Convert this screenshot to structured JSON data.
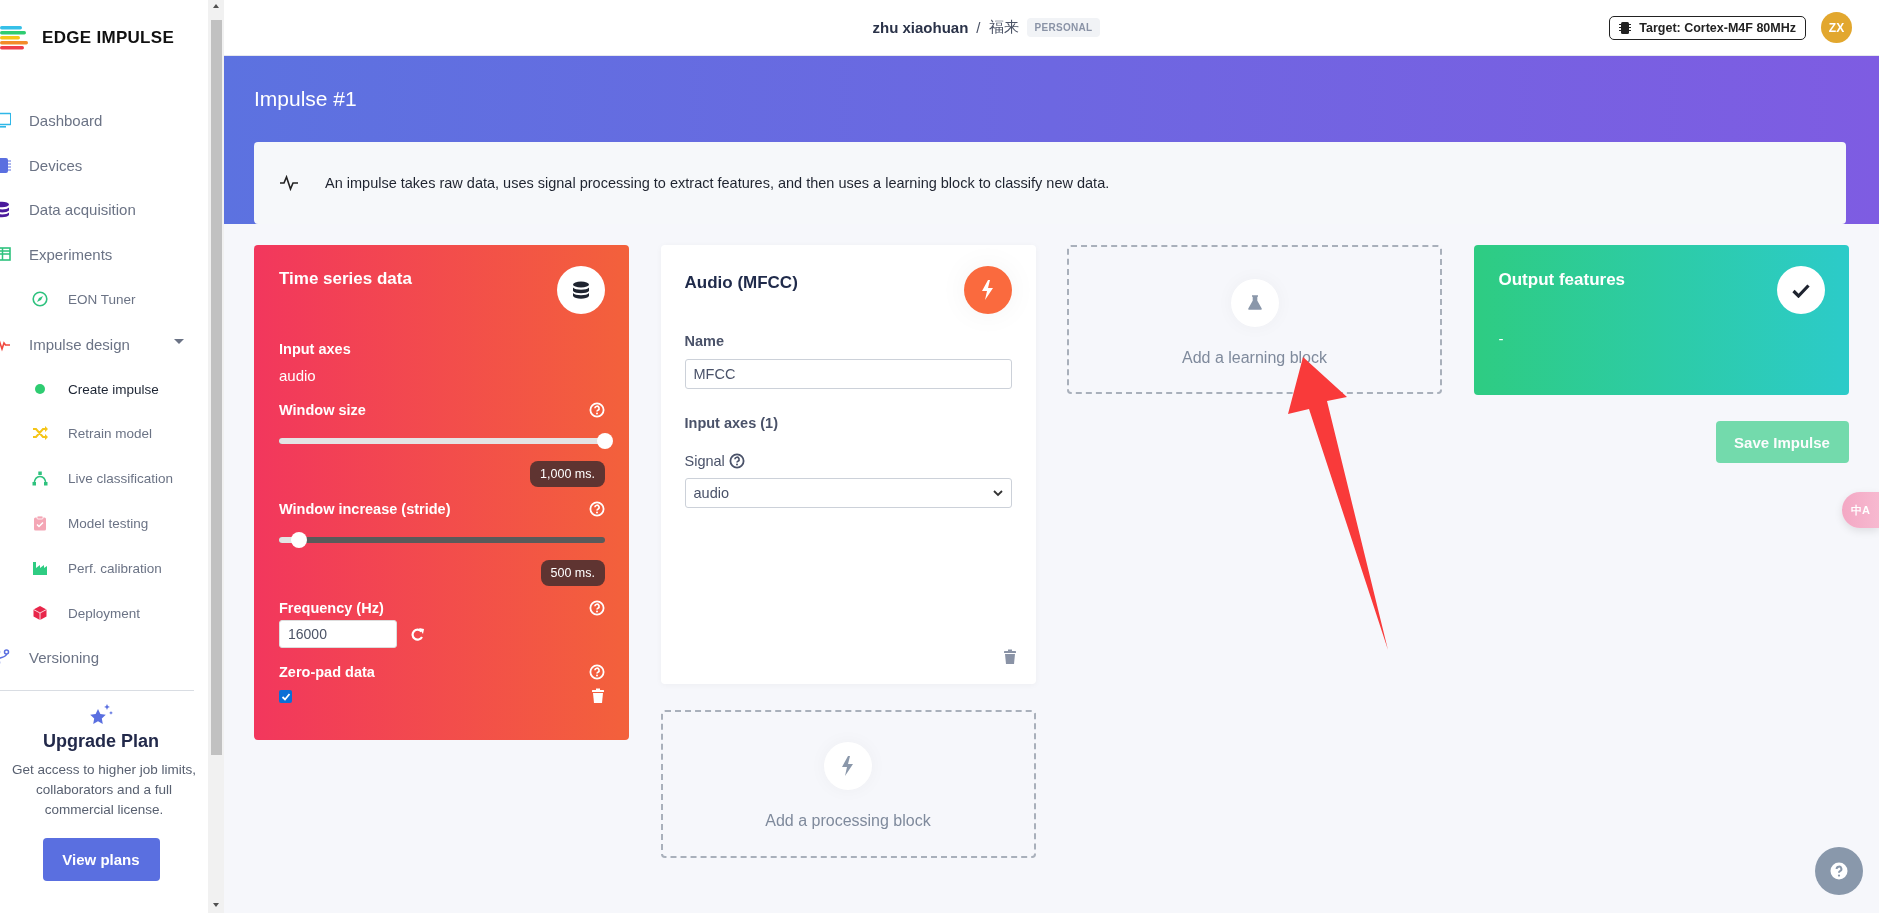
{
  "sidebar": {
    "logo_text": "EDGE IMPULSE",
    "items": [
      {
        "label": "Dashboard",
        "selected": false
      },
      {
        "label": "Devices",
        "selected": false
      },
      {
        "label": "Data acquisition",
        "selected": false
      },
      {
        "label": "Experiments",
        "selected": false,
        "children": [
          {
            "label": "EON Tuner",
            "selected": false
          }
        ]
      },
      {
        "label": "Impulse design",
        "selected": false,
        "expanded": true,
        "children": [
          {
            "label": "Create impulse",
            "selected": true
          },
          {
            "label": "Retrain model",
            "selected": false
          },
          {
            "label": "Live classification",
            "selected": false
          },
          {
            "label": "Model testing",
            "selected": false
          },
          {
            "label": "Perf. calibration",
            "selected": false
          },
          {
            "label": "Deployment",
            "selected": false
          }
        ]
      },
      {
        "label": "Versioning",
        "selected": false
      }
    ],
    "upgrade": {
      "title": "Upgrade Plan",
      "text": "Get access to higher job limits, collaborators and a full commercial license.",
      "button": "View plans"
    }
  },
  "topbar": {
    "user": "zhu xiaohuan",
    "separator": "/",
    "project": "福来",
    "badge": "PERSONAL",
    "target": "Target: Cortex-M4F 80MHz",
    "avatar": "ZX"
  },
  "header": {
    "title": "Impulse #1",
    "info": "An impulse takes raw data, uses signal processing to extract features, and then uses a learning block to classify new data."
  },
  "input_block": {
    "title": "Time series data",
    "axes_label": "Input axes",
    "axes_value": "audio",
    "sliders": [
      {
        "label": "Window size",
        "level": 1.0,
        "reading": "1,000 ms."
      },
      {
        "label": "Window increase (stride)",
        "level": 0.06,
        "reading": "500 ms."
      }
    ],
    "frequency": {
      "label": "Frequency (Hz)",
      "value": "16000"
    },
    "zero_pad": {
      "label": "Zero-pad data",
      "checked": true
    }
  },
  "processing_block": {
    "title": "Audio (MFCC)",
    "name_label": "Name",
    "name_value": "MFCC",
    "axes_label": "Input axes (1)",
    "signal_label": "Signal",
    "signal_value": "audio"
  },
  "add_processing": {
    "label": "Add a processing block"
  },
  "add_learning": {
    "label": "Add a learning block"
  },
  "output_block": {
    "title": "Output features",
    "value": "-"
  },
  "save_button": {
    "label": "Save Impulse",
    "disabled": true
  },
  "translate_button": {
    "label": "中A"
  }
}
